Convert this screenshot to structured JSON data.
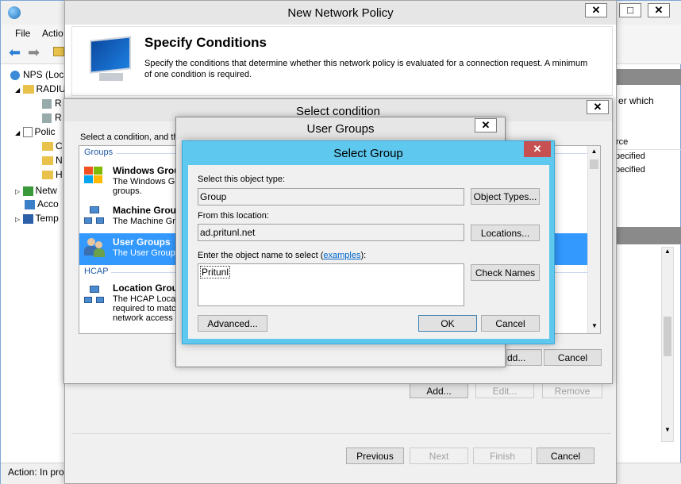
{
  "mmc": {
    "menu": [
      "File",
      "Actio"
    ],
    "tree": [
      "NPS (Loc",
      "RADIU",
      "R",
      "R",
      "Polic",
      "C",
      "N",
      "H",
      "Netw",
      "Acco",
      "Temp"
    ],
    "right_text1": "er which",
    "right_col_header": "rce",
    "right_rows": [
      "pecified",
      "pecified"
    ],
    "status": "Action:  In pro"
  },
  "wizard": {
    "title": "New Network Policy",
    "heading": "Specify Conditions",
    "description_line1": "Specify the conditions that determine whether this network policy is evaluated for a connection request. A minimum",
    "description_line2": "of one condition is required.",
    "add_label": "Add...",
    "edit_label": "Edit...",
    "remove_label": "Remove",
    "previous_label": "Previous",
    "next_label": "Next",
    "finish_label": "Finish",
    "cancel_label": "Cancel"
  },
  "select_condition": {
    "title": "Select condition",
    "instruction": "Select a condition, and th",
    "group_header_groups": "Groups",
    "group_header_hcap": "HCAP",
    "items": [
      {
        "title": "Windows Grou",
        "desc1": "The Windows G",
        "desc2": "groups."
      },
      {
        "title": "Machine Group",
        "desc1": "The Machine Gr",
        "desc2": ""
      },
      {
        "title": "User Groups",
        "desc1": "The User Groups",
        "desc2": ""
      },
      {
        "title": "Location Group",
        "desc1": "The HCAP Loca",
        "desc2": "required to matc",
        "desc3": "network access"
      }
    ],
    "add_label": "dd...",
    "cancel_label": "Cancel"
  },
  "user_groups": {
    "title": "User Groups"
  },
  "select_group": {
    "title": "Select Group",
    "object_type_label": "Select this object type:",
    "object_type_value": "Group",
    "object_types_button": "Object Types...",
    "location_label": "From this location:",
    "location_value": "ad.pritunl.net",
    "locations_button": "Locations...",
    "enter_name_label": "Enter the object name to select (",
    "examples_link": "examples",
    "enter_name_suffix": "):",
    "name_value": "Pritunl",
    "check_names_button": "Check Names",
    "advanced_button": "Advanced...",
    "ok_button": "OK",
    "cancel_button": "Cancel"
  }
}
